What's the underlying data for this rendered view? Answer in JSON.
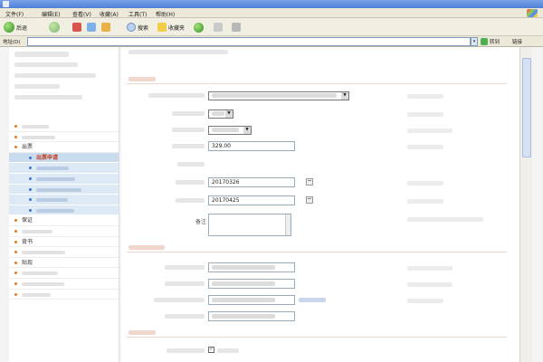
{
  "window": {
    "title": ""
  },
  "menu": [
    "文件(F)",
    "编辑(E)",
    "查看(V)",
    "收藏(A)",
    "工具(T)",
    "帮助(H)"
  ],
  "toolbar": {
    "back": "后退",
    "search": "搜索",
    "favorites": "收藏夹"
  },
  "address": {
    "label": "地址(D)",
    "url": "",
    "go": "转到",
    "links": "链接"
  },
  "breadcrumb": "",
  "sidebar": {
    "user_rows": [
      "",
      "",
      "",
      "",
      ""
    ],
    "nav": [
      {
        "label": "",
        "level": 0,
        "selected": false
      },
      {
        "label": "",
        "level": 0,
        "selected": false
      },
      {
        "label": "出票",
        "level": 0,
        "selected": false
      },
      {
        "label": "出票申请",
        "level": 1,
        "selected": true
      },
      {
        "label": "",
        "level": 1,
        "selected": false
      },
      {
        "label": "",
        "level": 1,
        "selected": false
      },
      {
        "label": "",
        "level": 1,
        "selected": false
      },
      {
        "label": "",
        "level": 1,
        "selected": false
      },
      {
        "label": "",
        "level": 1,
        "selected": false
      },
      {
        "label": "保证",
        "level": 0,
        "selected": false
      },
      {
        "label": "",
        "level": 0,
        "selected": false
      },
      {
        "label": "背书",
        "level": 0,
        "selected": false
      },
      {
        "label": "",
        "level": 0,
        "selected": false
      },
      {
        "label": "贴现",
        "level": 0,
        "selected": false
      },
      {
        "label": "",
        "level": 0,
        "selected": false
      },
      {
        "label": "",
        "level": 0,
        "selected": false
      },
      {
        "label": "",
        "level": 0,
        "selected": false
      }
    ]
  },
  "form": {
    "drawer": {
      "title": "",
      "fields": [
        {
          "label": "",
          "value": ""
        },
        {
          "label": "",
          "value": ""
        },
        {
          "label": "",
          "value": ""
        },
        {
          "label": "",
          "value": "329.00"
        },
        {
          "label": "",
          "value": ""
        },
        {
          "label": "",
          "value": "20170326"
        },
        {
          "label": "",
          "value": "20170425"
        },
        {
          "label": "备注",
          "value": ""
        }
      ]
    },
    "payee": {
      "title": "",
      "fields": [
        {
          "label": "",
          "value": ""
        },
        {
          "label": "",
          "value": ""
        },
        {
          "label": "",
          "value": "",
          "link": ""
        },
        {
          "label": "",
          "value": ""
        }
      ]
    },
    "acceptor": {
      "title": "",
      "fields": [
        {
          "label": "",
          "checkbox_label": ""
        }
      ]
    }
  }
}
